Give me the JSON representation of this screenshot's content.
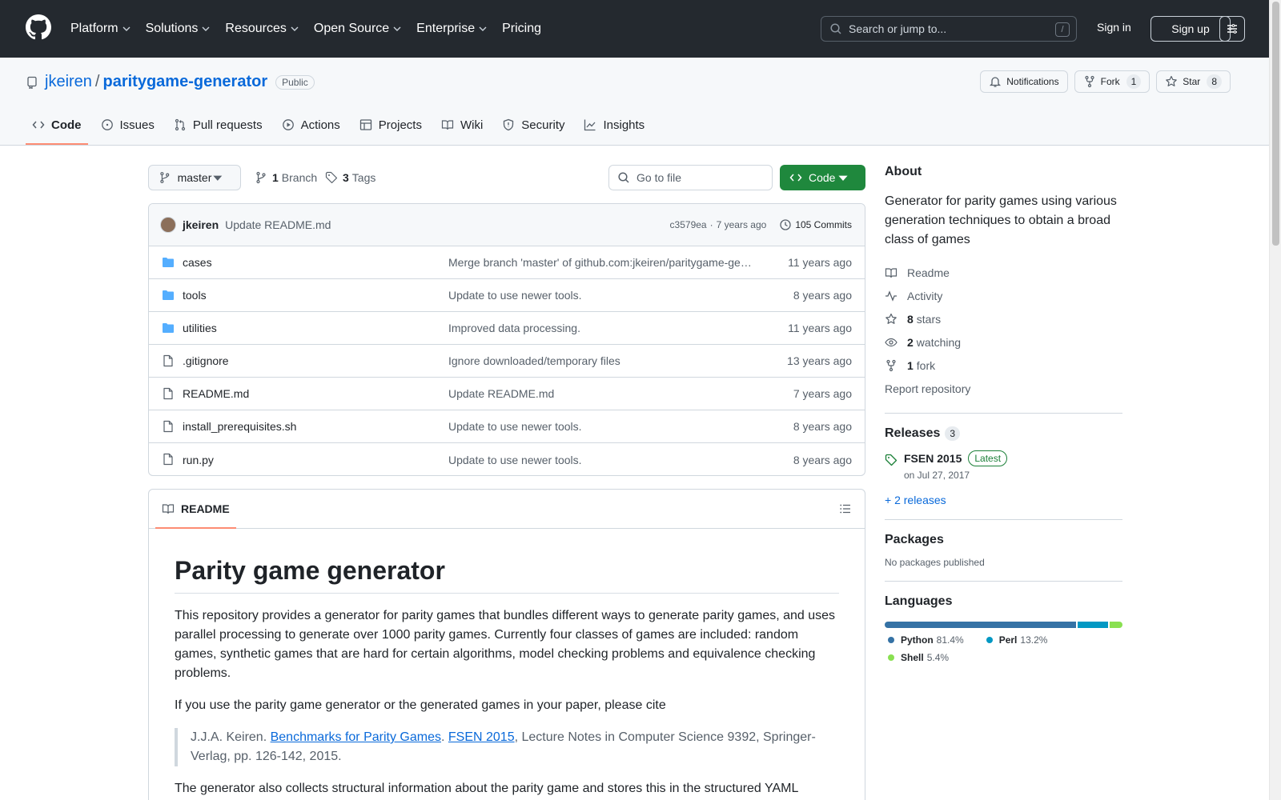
{
  "header": {
    "nav": [
      {
        "label": "Platform",
        "chevron": true
      },
      {
        "label": "Solutions",
        "chevron": true
      },
      {
        "label": "Resources",
        "chevron": true
      },
      {
        "label": "Open Source",
        "chevron": true
      },
      {
        "label": "Enterprise",
        "chevron": true
      },
      {
        "label": "Pricing",
        "chevron": false
      }
    ],
    "search_placeholder": "Search or jump to...",
    "search_shortcut": "/",
    "sign_in": "Sign in",
    "sign_up": "Sign up"
  },
  "repo": {
    "owner": "jkeiren",
    "separator": "/",
    "name": "paritygame-generator",
    "visibility": "Public",
    "notifications_label": "Notifications",
    "fork_label": "Fork",
    "fork_count": "1",
    "star_label": "Star",
    "star_count": "8"
  },
  "tabs": [
    {
      "label": "Code",
      "icon": "code-icon",
      "active": true
    },
    {
      "label": "Issues",
      "icon": "issue-icon",
      "active": false
    },
    {
      "label": "Pull requests",
      "icon": "pull-request-icon",
      "active": false
    },
    {
      "label": "Actions",
      "icon": "play-icon",
      "active": false
    },
    {
      "label": "Projects",
      "icon": "table-icon",
      "active": false
    },
    {
      "label": "Wiki",
      "icon": "book-icon",
      "active": false
    },
    {
      "label": "Security",
      "icon": "shield-icon",
      "active": false
    },
    {
      "label": "Insights",
      "icon": "graph-icon",
      "active": false
    }
  ],
  "toolbar": {
    "branch": "master",
    "branch_count": "1",
    "branch_label": "Branch",
    "tag_count": "3",
    "tag_label": "Tags",
    "go_to_file": "Go to file",
    "code_button": "Code"
  },
  "latest_commit": {
    "author": "jkeiren",
    "message": "Update README.md",
    "hash": "c3579ea",
    "dot": "·",
    "age": "7 years ago",
    "commits_label": "105 Commits"
  },
  "files": [
    {
      "name": "cases",
      "type": "folder",
      "message": "Merge branch 'master' of github.com:jkeiren/paritygame-generator",
      "age": "11 years ago"
    },
    {
      "name": "tools",
      "type": "folder",
      "message": "Update to use newer tools.",
      "age": "8 years ago"
    },
    {
      "name": "utilities",
      "type": "folder",
      "message": "Improved data processing.",
      "age": "11 years ago"
    },
    {
      "name": ".gitignore",
      "type": "file",
      "message": "Ignore downloaded/temporary files",
      "age": "13 years ago"
    },
    {
      "name": "README.md",
      "type": "file",
      "message": "Update README.md",
      "age": "7 years ago"
    },
    {
      "name": "install_prerequisites.sh",
      "type": "file",
      "message": "Update to use newer tools.",
      "age": "8 years ago"
    },
    {
      "name": "run.py",
      "type": "file",
      "message": "Update to use newer tools.",
      "age": "8 years ago"
    }
  ],
  "readme": {
    "tab_label": "README",
    "title": "Parity game generator",
    "p1": "This repository provides a generator for parity games that bundles different ways to generate parity games, and uses parallel processing to generate over 1000 parity games. Currently four classes of games are included: random games, synthetic games that are hard for certain algorithms, model checking problems and equivalence checking problems.",
    "p2": "If you use the parity game generator or the generated games in your paper, please cite",
    "quote_pre": "J.J.A. Keiren. ",
    "quote_link1": "Benchmarks for Parity Games",
    "quote_mid": ". ",
    "quote_link2": "FSEN 2015",
    "quote_post": ", Lecture Notes in Computer Science 9392, Springer-Verlag, pp. 126-142, 2015.",
    "p3": "The generator also collects structural information about the parity game and stores this in the structured YAML"
  },
  "about": {
    "heading": "About",
    "description": "Generator for parity games using various generation techniques to obtain a broad class of games",
    "readme": "Readme",
    "activity": "Activity",
    "stars_count": "8",
    "stars_label": "stars",
    "watching_count": "2",
    "watching_label": "watching",
    "fork_count": "1",
    "fork_label": "fork",
    "report": "Report repository"
  },
  "releases": {
    "heading": "Releases",
    "count": "3",
    "latest_name": "FSEN 2015",
    "latest_badge": "Latest",
    "latest_date": "on Jul 27, 2017",
    "more": "+ 2 releases"
  },
  "packages": {
    "heading": "Packages",
    "empty": "No packages published"
  },
  "languages": {
    "heading": "Languages",
    "items": [
      {
        "name": "Python",
        "percent": "81.4%",
        "value": 81.4,
        "color": "#3572A5"
      },
      {
        "name": "Perl",
        "percent": "13.2%",
        "value": 13.2,
        "color": "#0298c3"
      },
      {
        "name": "Shell",
        "percent": "5.4%",
        "value": 5.4,
        "color": "#89e051"
      }
    ]
  },
  "colors": {
    "header_bg": "#24292f",
    "link": "#0969da",
    "code_button": "#1f883d",
    "active_tab_underline": "#fd8c73",
    "folder": "#54aeff"
  }
}
